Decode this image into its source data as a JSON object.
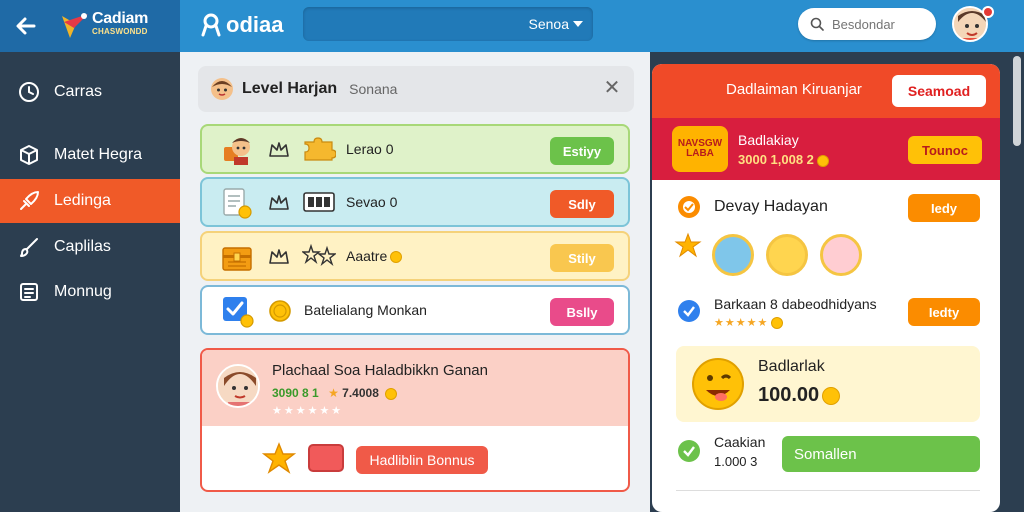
{
  "topbar": {
    "logo_title": "Cadiam",
    "logo_subtitle": "CHASWONDD",
    "brand": "odiaa",
    "season_select": "Senoa",
    "search_placeholder": "Besdondar"
  },
  "sidebar": {
    "items": [
      {
        "label": "Carras",
        "icon": "clock-icon",
        "active": false
      },
      {
        "label": "Matet Hegra",
        "icon": "cube-icon",
        "active": false
      },
      {
        "label": "Ledinga",
        "icon": "rocket-icon",
        "active": true
      },
      {
        "label": "Caplilas",
        "icon": "brush-icon",
        "active": false
      },
      {
        "label": "Monnug",
        "icon": "list-icon",
        "active": false
      }
    ]
  },
  "middle": {
    "title": "Level Harjan",
    "subtitle": "Sonana",
    "rows": [
      {
        "label": "Lerao 0",
        "button": "Estiyy",
        "bg": "#dff2c9",
        "border": "#a8d878",
        "btn_color": "#6cc24a"
      },
      {
        "label": "Sevao 0",
        "button": "Sdly",
        "bg": "#c9ecf1",
        "border": "#7cc4d8",
        "btn_color": "#f05a28"
      },
      {
        "label": "Aaatre",
        "button": "Stily",
        "bg": "#fff2c4",
        "border": "#f5d27a",
        "btn_color": "#f9c74f"
      },
      {
        "label": "Batelialang Monkan",
        "button": "Bslly",
        "bg": "#ffffff",
        "border": "#7cb9d8",
        "btn_color": "#e94b8a"
      }
    ],
    "feature": {
      "title": "Plachaal Soa Haladbikkn Ganan",
      "stats_a": "3090 8 1",
      "stats_b": "7.4008",
      "stars": "★★★★★★",
      "bonus_button": "Hadliblin Bonnus"
    }
  },
  "right": {
    "header_title": "Dadlaiman Kiruanjar",
    "header_button": "Seamoad",
    "promo": {
      "logo_text": "NAVSGW LABA",
      "title": "Badlakiay",
      "value": "3000 1,008 2",
      "button": "Tounoc"
    },
    "daily": {
      "label": "Devay Hadayan",
      "button": "Iedy"
    },
    "bonus": {
      "label": "Barkaan 8 dabeodhidyans",
      "stars": "★★★★★",
      "button": "Iedty"
    },
    "reward": {
      "title": "Badlarlak",
      "value": "100.00"
    },
    "claim": {
      "label": "Caakian",
      "value": "1.000 3",
      "button": "Somallen"
    }
  }
}
